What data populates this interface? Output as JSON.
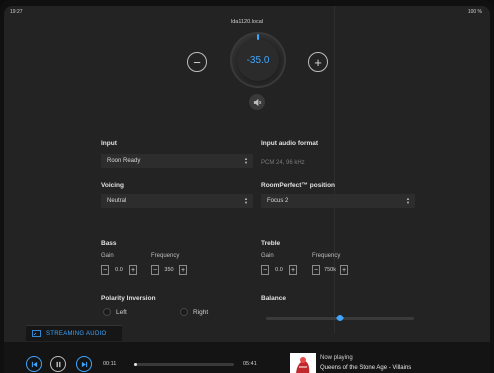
{
  "status": {
    "time": "19:27",
    "right": "100 %"
  },
  "header": {
    "host": "lda1120.local"
  },
  "volume": {
    "value": "-35.0",
    "minus": "−",
    "plus": "+"
  },
  "input": {
    "label": "Input",
    "value": "Roon Ready"
  },
  "input_format": {
    "label": "Input audio format",
    "value": "PCM 24, 96 kHz"
  },
  "voicing": {
    "label": "Voicing",
    "value": "Neutral"
  },
  "roomperfect": {
    "label": "RoomPerfect™ position",
    "value": "Focus 2"
  },
  "bass": {
    "label": "Bass",
    "gain_label": "Gain",
    "freq_label": "Frequency",
    "gain": "0.0",
    "freq": "350"
  },
  "treble": {
    "label": "Treble",
    "gain_label": "Gain",
    "freq_label": "Frequency",
    "gain": "0.0",
    "freq": "750k"
  },
  "polarity": {
    "label": "Polarity Inversion",
    "left": "Left",
    "right": "Right"
  },
  "balance": {
    "label": "Balance",
    "value": 0.5
  },
  "streaming": {
    "label": "STREAMING AUDIO"
  },
  "player": {
    "elapsed": "00:11",
    "total": "05:41",
    "progress": 0.03,
    "now_label": "Now playing",
    "track": "Queens of the Stone Age - Villains"
  },
  "colors": {
    "accent": "#3ea6ff",
    "background": "#232323"
  },
  "icons": [
    "minus-icon",
    "plus-icon",
    "mute-icon",
    "skip-back-icon",
    "pause-icon",
    "skip-forward-icon",
    "streaming-icon"
  ]
}
